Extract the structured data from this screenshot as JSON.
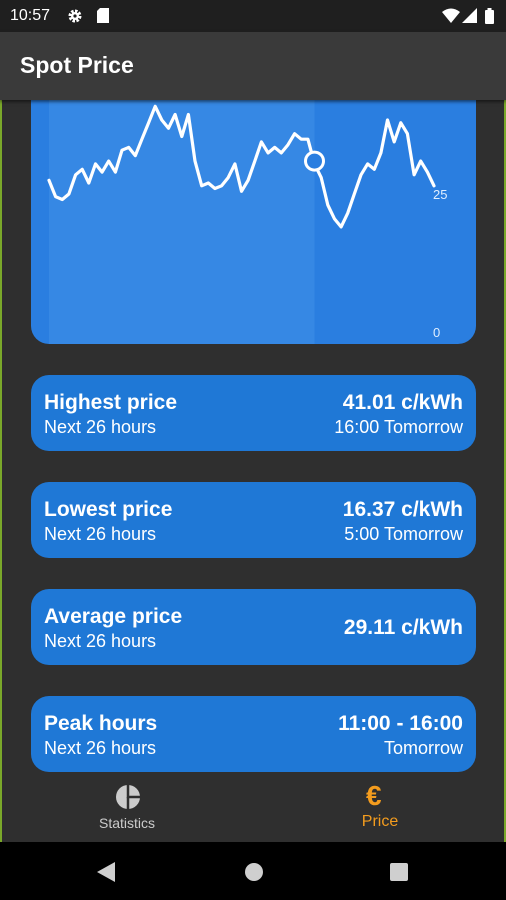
{
  "status_bar": {
    "time": "10:57",
    "icons": [
      "gear-icon",
      "sd-card-icon",
      "wifi-icon",
      "signal-icon",
      "battery-icon"
    ]
  },
  "app_bar": {
    "title": "Spot Price"
  },
  "chart": {
    "type": "line",
    "y_tick_labels": [
      "25",
      "0"
    ],
    "line_color": "#ffffff",
    "fill_color": "#2a7ee0",
    "past_shade_color": "#3f8fe6",
    "values": [
      27.5,
      24.5,
      24,
      25,
      28.5,
      29.5,
      27,
      30.5,
      29,
      31,
      29,
      33,
      33.5,
      32,
      35,
      38,
      41,
      38.5,
      37,
      39.5,
      35.5,
      39.5,
      31,
      26.5,
      27,
      26,
      26.5,
      28,
      30.5,
      25.5,
      27.5,
      31,
      34.5,
      32.5,
      33.5,
      32.5,
      34,
      36,
      35,
      35,
      30.5,
      28,
      23,
      20.5,
      19,
      21.5,
      25,
      28.5,
      30.5,
      29.5,
      32.5,
      38.5,
      34.5,
      38,
      36,
      28.5,
      31,
      29,
      26.5
    ],
    "current_value": 31
  },
  "cards": [
    {
      "title": "Highest price",
      "subtitle": "Next 26 hours",
      "value": "41.01 c/kWh",
      "detail": "16:00 Tomorrow"
    },
    {
      "title": "Lowest price",
      "subtitle": "Next 26 hours",
      "value": "16.37 c/kWh",
      "detail": "5:00 Tomorrow"
    },
    {
      "title": "Average price",
      "subtitle": "Next 26 hours",
      "value": "29.11 c/kWh"
    },
    {
      "title": "Peak hours",
      "subtitle": "Next 26 hours",
      "value": "11:00 - 16:00",
      "detail": "Tomorrow"
    }
  ],
  "bottom_nav": {
    "items": [
      {
        "label": "Statistics",
        "icon": "pie-chart-icon",
        "color": "#cccccc",
        "active": false
      },
      {
        "label": "Price",
        "icon": "euro-icon",
        "color": "#f39c1e",
        "active": true
      }
    ]
  }
}
